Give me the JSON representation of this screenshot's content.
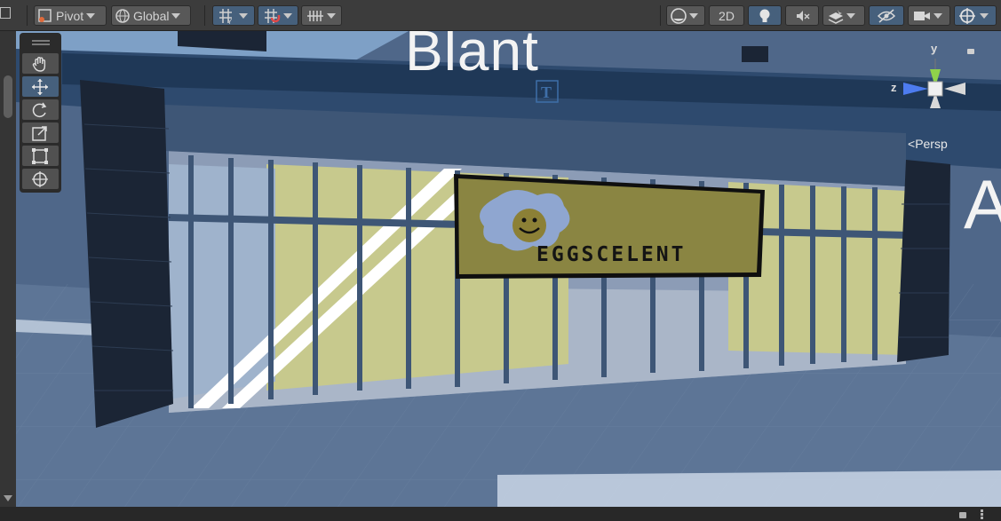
{
  "toolbar": {
    "pivot_label": "Pivot",
    "global_label": "Global",
    "view_2d_label": "2D",
    "icons": [
      "pivot-mode-icon",
      "global-space-icon",
      "grid-snap-icon",
      "snap-increment-icon",
      "grid-visibility-icon",
      "shading-mode-icon",
      "lighting-icon",
      "audio-icon",
      "effects-icon",
      "hidden-objects-icon",
      "camera-icon",
      "gizmos-icon"
    ]
  },
  "tools": [
    "view-tool",
    "move-tool",
    "rotate-tool",
    "scale-tool",
    "rect-tool",
    "transform-tool"
  ],
  "gizmo": {
    "y_label": "y",
    "z_label": "z",
    "projection_label": "Persp"
  },
  "scene": {
    "banner_text": "Blant",
    "right_text": "A",
    "sign_text": "EGGSCELENT"
  },
  "colors": {
    "toolbar": "#3c3c3c",
    "active": "#46607c",
    "sign_bg": "#8a8542"
  }
}
